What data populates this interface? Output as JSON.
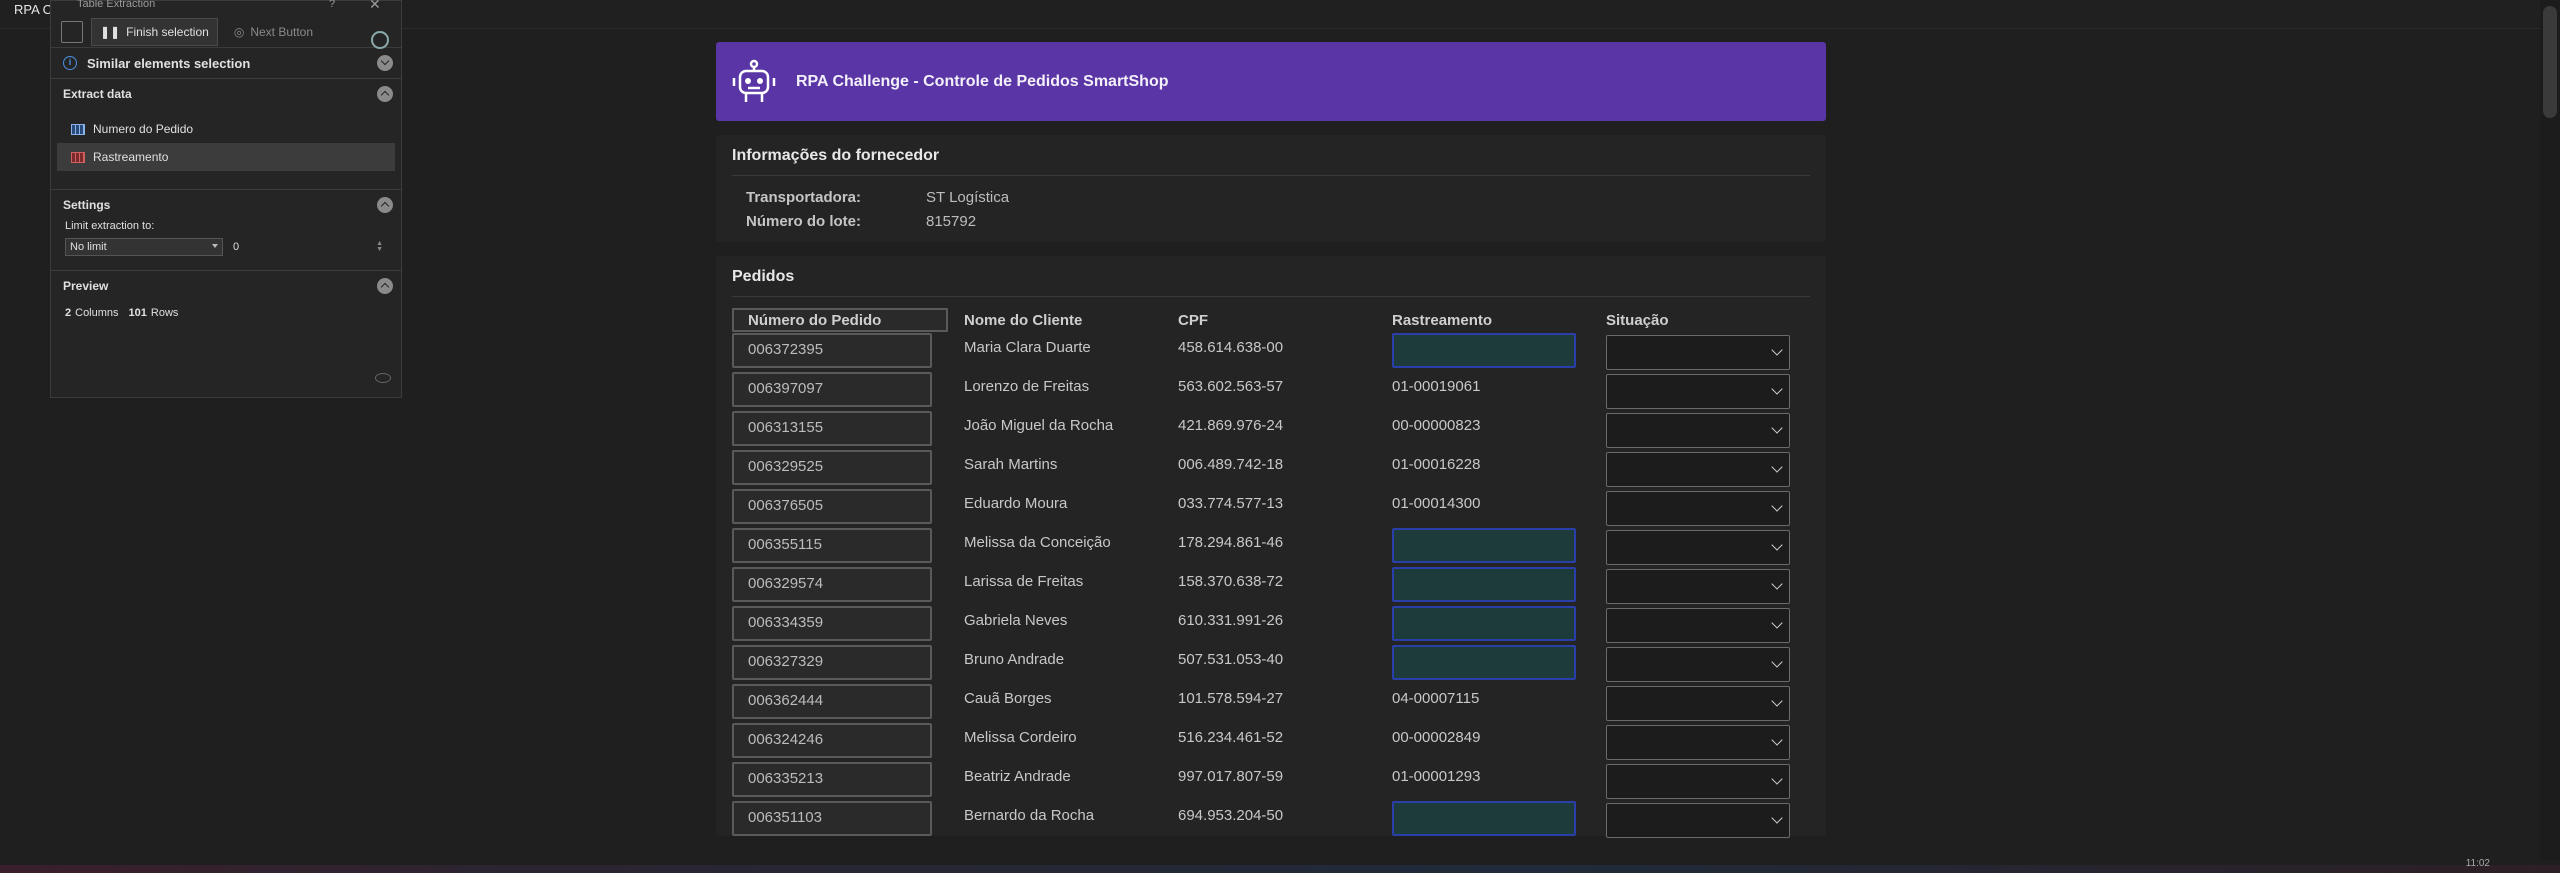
{
  "topbar": {
    "brand": "RPA C"
  },
  "panel": {
    "title": "Table Extraction",
    "help": "?",
    "close": "✕",
    "finish_label": "Finish selection",
    "next_label": "Next Button",
    "similar_label": "Similar elements selection",
    "extract_label": "Extract data",
    "fields": [
      {
        "label": "Numero do Pedido"
      },
      {
        "label": "Rastreamento"
      }
    ],
    "settings_label": "Settings",
    "limit_label": "Limit extraction to:",
    "limit_option": "No limit",
    "limit_value": "0",
    "preview_label": "Preview",
    "preview_cols": "2",
    "preview_cols_word": "Columns",
    "preview_rows": "101",
    "preview_rows_word": "Rows"
  },
  "app": {
    "title": "RPA Challenge - Controle de Pedidos SmartShop",
    "supplier_heading": "Informações do fornecedor",
    "carrier_label": "Transportadora:",
    "carrier_value": "ST Logística",
    "batch_label": "Número do lote:",
    "batch_value": "815792",
    "orders_heading": "Pedidos",
    "columns": [
      "Número do Pedido",
      "Nome do Cliente",
      "CPF",
      "Rastreamento",
      "Situação"
    ],
    "rows": [
      {
        "id": "006372395",
        "name": "Maria Clara Duarte",
        "cpf": "458.614.638-00",
        "tracking": ""
      },
      {
        "id": "006397097",
        "name": "Lorenzo de Freitas",
        "cpf": "563.602.563-57",
        "tracking": "01-00019061"
      },
      {
        "id": "006313155",
        "name": "João Miguel da Rocha",
        "cpf": "421.869.976-24",
        "tracking": "00-00000823"
      },
      {
        "id": "006329525",
        "name": "Sarah Martins",
        "cpf": "006.489.742-18",
        "tracking": "01-00016228"
      },
      {
        "id": "006376505",
        "name": "Eduardo Moura",
        "cpf": "033.774.577-13",
        "tracking": "01-00014300"
      },
      {
        "id": "006355115",
        "name": "Melissa da Conceição",
        "cpf": "178.294.861-46",
        "tracking": ""
      },
      {
        "id": "006329574",
        "name": "Larissa de Freitas",
        "cpf": "158.370.638-72",
        "tracking": ""
      },
      {
        "id": "006334359",
        "name": "Gabriela Neves",
        "cpf": "610.331.991-26",
        "tracking": ""
      },
      {
        "id": "006327329",
        "name": "Bruno Andrade",
        "cpf": "507.531.053-40",
        "tracking": ""
      },
      {
        "id": "006362444",
        "name": "Cauã Borges",
        "cpf": "101.578.594-27",
        "tracking": "04-00007115"
      },
      {
        "id": "006324246",
        "name": "Melissa Cordeiro",
        "cpf": "516.234.461-52",
        "tracking": "00-00002849"
      },
      {
        "id": "006335213",
        "name": "Beatriz Andrade",
        "cpf": "997.017.807-59",
        "tracking": "01-00001293"
      },
      {
        "id": "006351103",
        "name": "Bernardo da Rocha",
        "cpf": "694.953.204-50",
        "tracking": ""
      }
    ]
  },
  "taskbar": {
    "clock": "11:02"
  }
}
